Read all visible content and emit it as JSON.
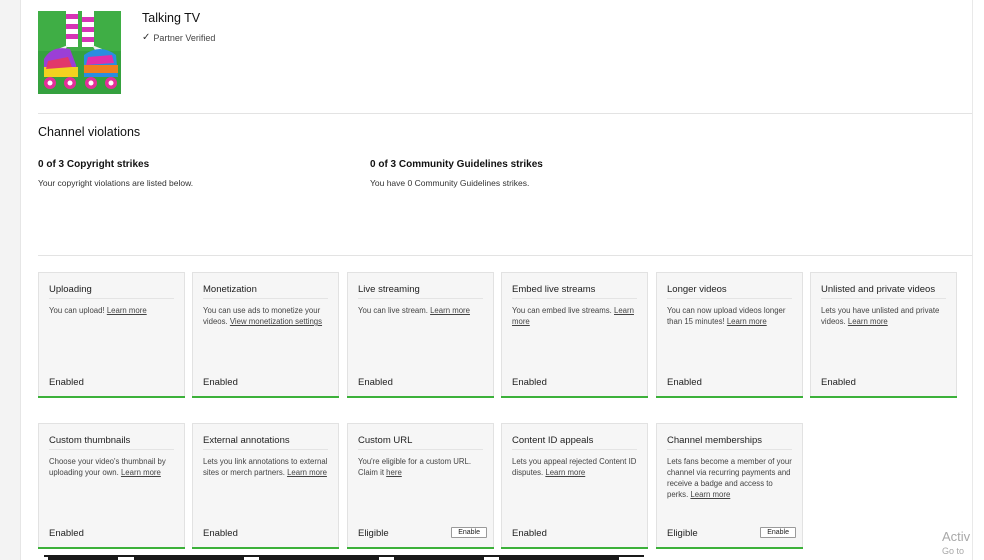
{
  "channel": {
    "name": "Talking TV",
    "verified_label": "Partner Verified"
  },
  "violations": {
    "title": "Channel violations",
    "copyright": {
      "title": "0 of 3 Copyright strikes",
      "desc": "Your copyright violations are listed below."
    },
    "community": {
      "title": "0 of 3 Community Guidelines strikes",
      "desc": "You have 0 Community Guidelines strikes."
    }
  },
  "features": [
    {
      "title": "Uploading",
      "desc": "You can upload! ",
      "link": "Learn more",
      "status": "Enabled"
    },
    {
      "title": "Monetization",
      "desc": "You can use ads to monetize your videos. ",
      "link": "View monetization settings",
      "status": "Enabled"
    },
    {
      "title": "Live streaming",
      "desc": "You can live stream. ",
      "link": "Learn more",
      "status": "Enabled"
    },
    {
      "title": "Embed live streams",
      "desc": "You can embed live streams. ",
      "link": "Learn more",
      "status": "Enabled"
    },
    {
      "title": "Longer videos",
      "desc": "You can now upload videos longer than 15 minutes! ",
      "link": "Learn more",
      "status": "Enabled"
    },
    {
      "title": "Unlisted and private videos",
      "desc": "Lets you have unlisted and private videos. ",
      "link": "Learn more",
      "status": "Enabled"
    },
    {
      "title": "Custom thumbnails",
      "desc": "Choose your video's thumbnail by uploading your own. ",
      "link": "Learn more",
      "status": "Enabled"
    },
    {
      "title": "External annotations",
      "desc": "Lets you link annotations to external sites or merch partners. ",
      "link": "Learn more",
      "status": "Enabled"
    },
    {
      "title": "Custom URL",
      "desc": "You're eligible for a custom URL. Claim it ",
      "link": "here",
      "status": "Eligible",
      "button": "Enable"
    },
    {
      "title": "Content ID appeals",
      "desc": "Lets you appeal rejected Content ID disputes. ",
      "link": "Learn more",
      "status": "Enabled"
    },
    {
      "title": "Channel memberships",
      "desc": "Lets fans become a member of your channel via recurring payments and receive a badge and access to perks. ",
      "link": "Learn more",
      "status": "Eligible",
      "button": "Enable"
    }
  ],
  "watermark": {
    "line1": "Activ",
    "line2": "Go to"
  },
  "colors": {
    "status_bar": "#3cb13a",
    "card_bg": "#f6f6f6"
  }
}
